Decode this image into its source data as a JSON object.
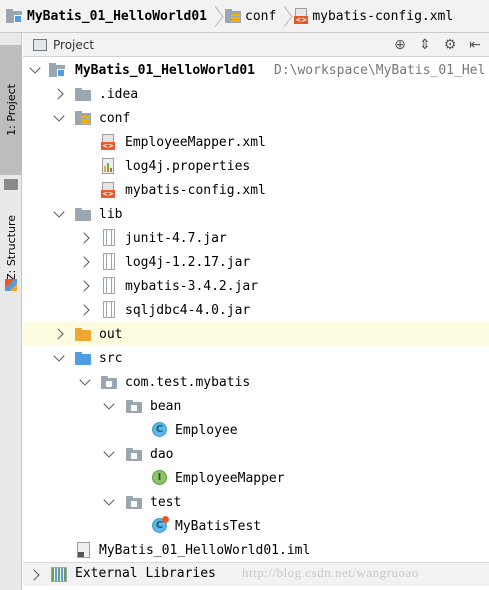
{
  "breadcrumb": [
    {
      "label": "MyBatis_01_HelloWorld01",
      "icon": "module-folder-icon",
      "bold": true
    },
    {
      "label": "conf",
      "icon": "config-folder-icon"
    },
    {
      "label": "mybatis-config.xml",
      "icon": "xml-file-icon"
    }
  ],
  "tool_stripe": {
    "project_tab": "1: Project",
    "structure_tab": "Z: Structure"
  },
  "project_panel": {
    "title": "Project",
    "tools": [
      "locate-icon",
      "collapse-icon",
      "gear-icon",
      "hide-icon"
    ]
  },
  "tree": {
    "root": {
      "label": "MyBatis_01_HelloWorld01",
      "path": "D:\\workspace\\MyBatis_01_Hel"
    },
    "idea": "idea",
    "idea_label": ".idea",
    "conf": "conf",
    "conf_files": [
      "EmployeeMapper.xml",
      "log4j.properties",
      "mybatis-config.xml"
    ],
    "lib": "lib",
    "lib_jars": [
      "junit-4.7.jar",
      "log4j-1.2.17.jar",
      "mybatis-3.4.2.jar",
      "sqljdbc4-4.0.jar"
    ],
    "out": "out",
    "src": "src",
    "package": "com.test.mybatis",
    "bean": "bean",
    "employee": "Employee",
    "dao": "dao",
    "employee_mapper": "EmployeeMapper",
    "test": "test",
    "mybatis_test": "MyBatisTest",
    "iml": "MyBatis_01_HelloWorld01.iml",
    "external_libraries": "External Libraries"
  },
  "watermark": "http://blog.csdn.net/wangruoao",
  "colors": {
    "selected_row": "#fdfbe0",
    "src_folder": "#4f9ee3",
    "out_folder": "#f0a732",
    "xml_badge": "#e55a2b",
    "class_icon": "#5eb8e6",
    "interface_icon": "#8cc36c"
  }
}
